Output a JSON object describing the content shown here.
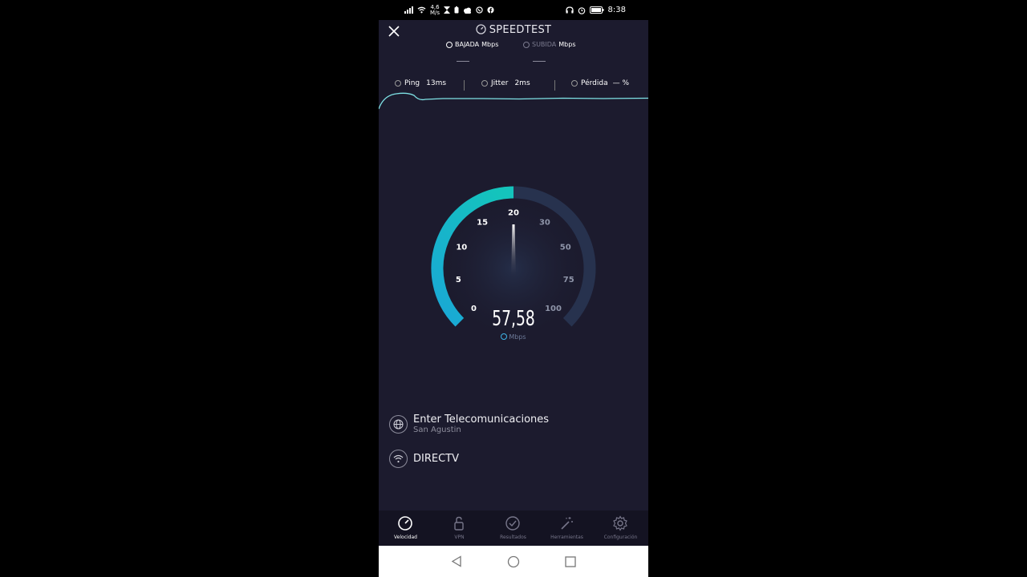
{
  "status_bar": {
    "net_speed_value": "4,6",
    "net_speed_unit": "M/s",
    "time": "8:38"
  },
  "header": {
    "title": "SPEEDTEST",
    "download_label": "BAJADA",
    "upload_label": "SUBIDA",
    "unit": "Mbps",
    "download_value": "—",
    "upload_value": "—"
  },
  "metrics": {
    "ping_label": "Ping",
    "ping_value": "13ms",
    "jitter_label": "Jitter",
    "jitter_value": "2ms",
    "loss_label": "Pérdida",
    "loss_value": "— %"
  },
  "gauge": {
    "ticks": [
      "0",
      "5",
      "10",
      "15",
      "20",
      "30",
      "50",
      "75",
      "100"
    ],
    "needle_value": 20,
    "speed": "57,58",
    "speed_unit": "Mbps",
    "colors": {
      "active": "#1aa7d6",
      "active_end": "#14c4bc",
      "inactive": "#27324e"
    }
  },
  "connection": {
    "isp": "Enter Telecomunicaciones",
    "location": "San Agustin",
    "wifi": "DIRECTV"
  },
  "nav": {
    "items": [
      {
        "label": "Velocidad",
        "icon": "speedometer-icon"
      },
      {
        "label": "VPN",
        "icon": "lock-icon"
      },
      {
        "label": "Resultados",
        "icon": "check-circle-icon"
      },
      {
        "label": "Herramientas",
        "icon": "magic-wand-icon"
      },
      {
        "label": "Configuración",
        "icon": "gear-icon"
      }
    ]
  }
}
